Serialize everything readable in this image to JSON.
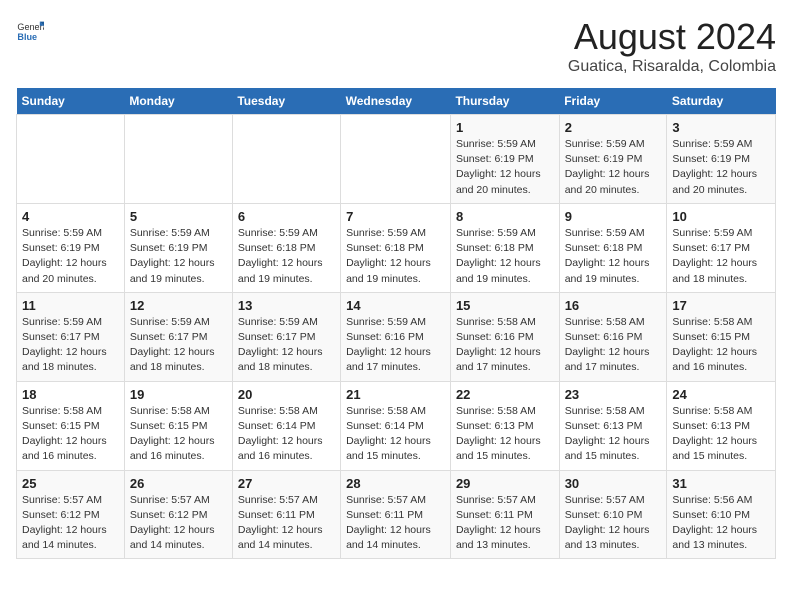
{
  "header": {
    "logo_general": "General",
    "logo_blue": "Blue",
    "title": "August 2024",
    "subtitle": "Guatica, Risaralda, Colombia"
  },
  "days_of_week": [
    "Sunday",
    "Monday",
    "Tuesday",
    "Wednesday",
    "Thursday",
    "Friday",
    "Saturday"
  ],
  "weeks": [
    [
      {
        "day": "",
        "info": ""
      },
      {
        "day": "",
        "info": ""
      },
      {
        "day": "",
        "info": ""
      },
      {
        "day": "",
        "info": ""
      },
      {
        "day": "1",
        "info": "Sunrise: 5:59 AM\nSunset: 6:19 PM\nDaylight: 12 hours and 20 minutes."
      },
      {
        "day": "2",
        "info": "Sunrise: 5:59 AM\nSunset: 6:19 PM\nDaylight: 12 hours and 20 minutes."
      },
      {
        "day": "3",
        "info": "Sunrise: 5:59 AM\nSunset: 6:19 PM\nDaylight: 12 hours and 20 minutes."
      }
    ],
    [
      {
        "day": "4",
        "info": "Sunrise: 5:59 AM\nSunset: 6:19 PM\nDaylight: 12 hours and 20 minutes."
      },
      {
        "day": "5",
        "info": "Sunrise: 5:59 AM\nSunset: 6:19 PM\nDaylight: 12 hours and 19 minutes."
      },
      {
        "day": "6",
        "info": "Sunrise: 5:59 AM\nSunset: 6:18 PM\nDaylight: 12 hours and 19 minutes."
      },
      {
        "day": "7",
        "info": "Sunrise: 5:59 AM\nSunset: 6:18 PM\nDaylight: 12 hours and 19 minutes."
      },
      {
        "day": "8",
        "info": "Sunrise: 5:59 AM\nSunset: 6:18 PM\nDaylight: 12 hours and 19 minutes."
      },
      {
        "day": "9",
        "info": "Sunrise: 5:59 AM\nSunset: 6:18 PM\nDaylight: 12 hours and 19 minutes."
      },
      {
        "day": "10",
        "info": "Sunrise: 5:59 AM\nSunset: 6:17 PM\nDaylight: 12 hours and 18 minutes."
      }
    ],
    [
      {
        "day": "11",
        "info": "Sunrise: 5:59 AM\nSunset: 6:17 PM\nDaylight: 12 hours and 18 minutes."
      },
      {
        "day": "12",
        "info": "Sunrise: 5:59 AM\nSunset: 6:17 PM\nDaylight: 12 hours and 18 minutes."
      },
      {
        "day": "13",
        "info": "Sunrise: 5:59 AM\nSunset: 6:17 PM\nDaylight: 12 hours and 18 minutes."
      },
      {
        "day": "14",
        "info": "Sunrise: 5:59 AM\nSunset: 6:16 PM\nDaylight: 12 hours and 17 minutes."
      },
      {
        "day": "15",
        "info": "Sunrise: 5:58 AM\nSunset: 6:16 PM\nDaylight: 12 hours and 17 minutes."
      },
      {
        "day": "16",
        "info": "Sunrise: 5:58 AM\nSunset: 6:16 PM\nDaylight: 12 hours and 17 minutes."
      },
      {
        "day": "17",
        "info": "Sunrise: 5:58 AM\nSunset: 6:15 PM\nDaylight: 12 hours and 16 minutes."
      }
    ],
    [
      {
        "day": "18",
        "info": "Sunrise: 5:58 AM\nSunset: 6:15 PM\nDaylight: 12 hours and 16 minutes."
      },
      {
        "day": "19",
        "info": "Sunrise: 5:58 AM\nSunset: 6:15 PM\nDaylight: 12 hours and 16 minutes."
      },
      {
        "day": "20",
        "info": "Sunrise: 5:58 AM\nSunset: 6:14 PM\nDaylight: 12 hours and 16 minutes."
      },
      {
        "day": "21",
        "info": "Sunrise: 5:58 AM\nSunset: 6:14 PM\nDaylight: 12 hours and 15 minutes."
      },
      {
        "day": "22",
        "info": "Sunrise: 5:58 AM\nSunset: 6:13 PM\nDaylight: 12 hours and 15 minutes."
      },
      {
        "day": "23",
        "info": "Sunrise: 5:58 AM\nSunset: 6:13 PM\nDaylight: 12 hours and 15 minutes."
      },
      {
        "day": "24",
        "info": "Sunrise: 5:58 AM\nSunset: 6:13 PM\nDaylight: 12 hours and 15 minutes."
      }
    ],
    [
      {
        "day": "25",
        "info": "Sunrise: 5:57 AM\nSunset: 6:12 PM\nDaylight: 12 hours and 14 minutes."
      },
      {
        "day": "26",
        "info": "Sunrise: 5:57 AM\nSunset: 6:12 PM\nDaylight: 12 hours and 14 minutes."
      },
      {
        "day": "27",
        "info": "Sunrise: 5:57 AM\nSunset: 6:11 PM\nDaylight: 12 hours and 14 minutes."
      },
      {
        "day": "28",
        "info": "Sunrise: 5:57 AM\nSunset: 6:11 PM\nDaylight: 12 hours and 14 minutes."
      },
      {
        "day": "29",
        "info": "Sunrise: 5:57 AM\nSunset: 6:11 PM\nDaylight: 12 hours and 13 minutes."
      },
      {
        "day": "30",
        "info": "Sunrise: 5:57 AM\nSunset: 6:10 PM\nDaylight: 12 hours and 13 minutes."
      },
      {
        "day": "31",
        "info": "Sunrise: 5:56 AM\nSunset: 6:10 PM\nDaylight: 12 hours and 13 minutes."
      }
    ]
  ]
}
